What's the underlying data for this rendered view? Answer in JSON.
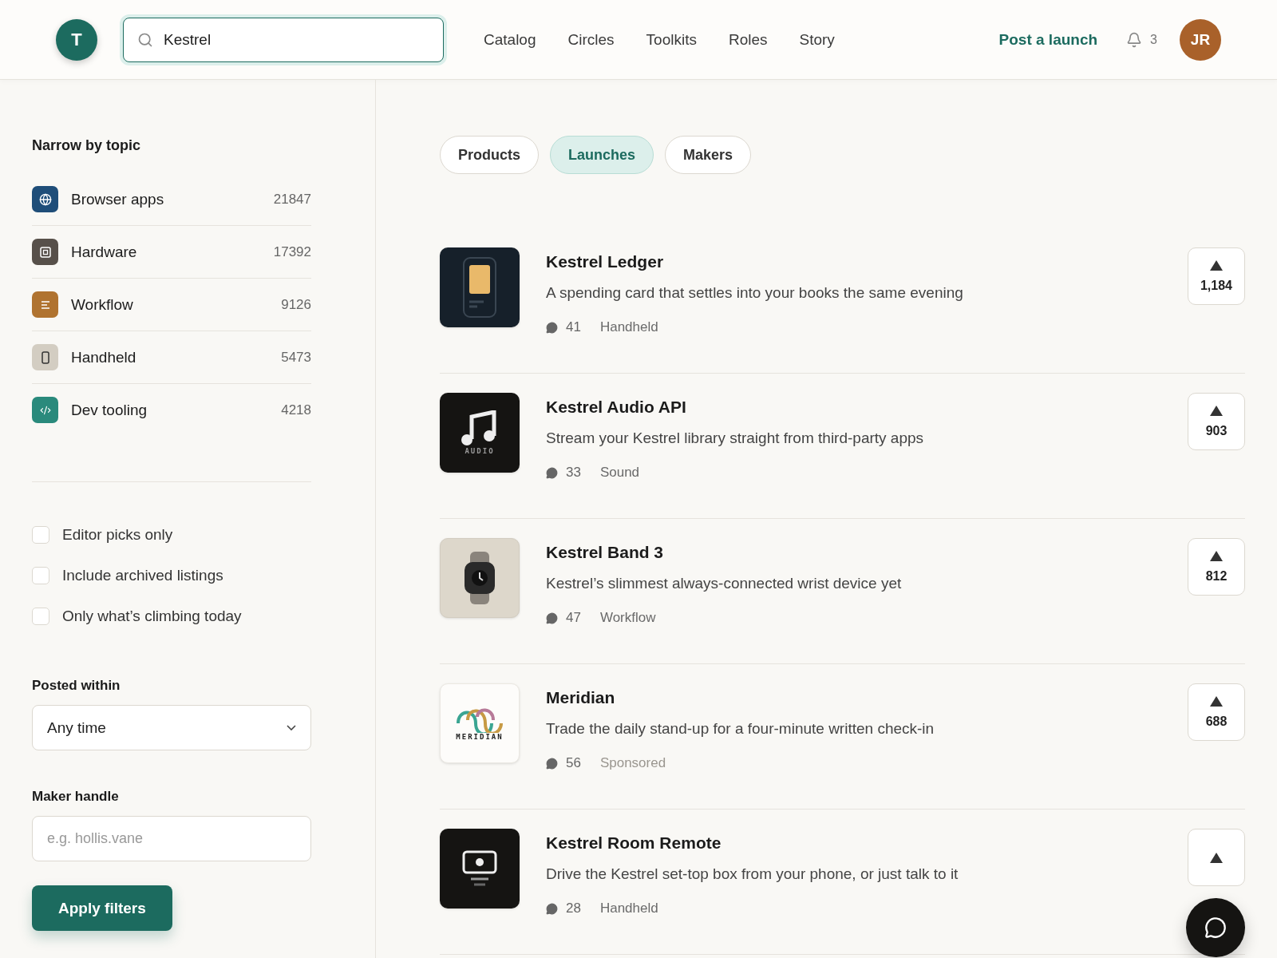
{
  "header": {
    "logo_letter": "T",
    "search": {
      "value": "Kestrel"
    },
    "nav": [
      "Catalog",
      "Circles",
      "Toolkits",
      "Roles",
      "Story"
    ],
    "post_button": "Post a launch",
    "notification_count": "3",
    "avatar_initials": "JR"
  },
  "sidebar": {
    "topic_title": "Narrow by topic",
    "topics": [
      {
        "label": "Browser apps",
        "count": "21847",
        "kind": "globe",
        "color": "#1f4e79"
      },
      {
        "label": "Hardware",
        "count": "17392",
        "kind": "chip",
        "color": "#57504a"
      },
      {
        "label": "Workflow",
        "count": "9126",
        "kind": "lines",
        "color": "#b07330"
      },
      {
        "label": "Handheld",
        "count": "5473",
        "kind": "phone",
        "color": "#d3cdc2"
      },
      {
        "label": "Dev tooling",
        "count": "4218",
        "kind": "code",
        "color": "#2a8a7c"
      }
    ],
    "checkboxes": [
      {
        "label": "Editor picks only",
        "checked": false
      },
      {
        "label": "Include archived listings",
        "checked": false
      },
      {
        "label": "Only what’s climbing today",
        "checked": false
      }
    ],
    "posted_within": {
      "label": "Posted within",
      "value": "Any time"
    },
    "maker_handle": {
      "label": "Maker handle",
      "placeholder": "e.g. hollis.vane"
    },
    "apply_button": "Apply filters"
  },
  "tabs": [
    {
      "label": "Products",
      "selected": false
    },
    {
      "label": "Launches",
      "selected": true
    },
    {
      "label": "Makers",
      "selected": false
    }
  ],
  "launches": [
    {
      "title": "Kestrel Ledger",
      "description": "A spending card that settles into your books the same evening",
      "comments": "41",
      "tag": "Handheld",
      "sponsored": false,
      "votes": "1,184",
      "logo": {
        "kind": "card"
      }
    },
    {
      "title": "Kestrel Audio API",
      "description": "Stream your Kestrel library straight from third-party apps",
      "comments": "33",
      "tag": "Sound",
      "sponsored": false,
      "votes": "903",
      "logo": {
        "kind": "audio",
        "text": "AUDIO"
      }
    },
    {
      "title": "Kestrel Band 3",
      "description": "Kestrel’s slimmest always-connected wrist device yet",
      "comments": "47",
      "tag": "Workflow",
      "sponsored": false,
      "votes": "812",
      "logo": {
        "kind": "watch"
      }
    },
    {
      "title": "Meridian",
      "description": "Trade the daily stand-up for a four-minute written check-in",
      "comments": "56",
      "tag": "Sponsored",
      "sponsored": true,
      "votes": "688",
      "logo": {
        "kind": "meridian",
        "text": "MERIDIAN"
      }
    },
    {
      "title": "Kestrel Room Remote",
      "description": "Drive the Kestrel set-top box from your phone, or just talk to it",
      "comments": "28",
      "tag": "Handheld",
      "sponsored": false,
      "logo": {
        "kind": "remote"
      }
    }
  ]
}
